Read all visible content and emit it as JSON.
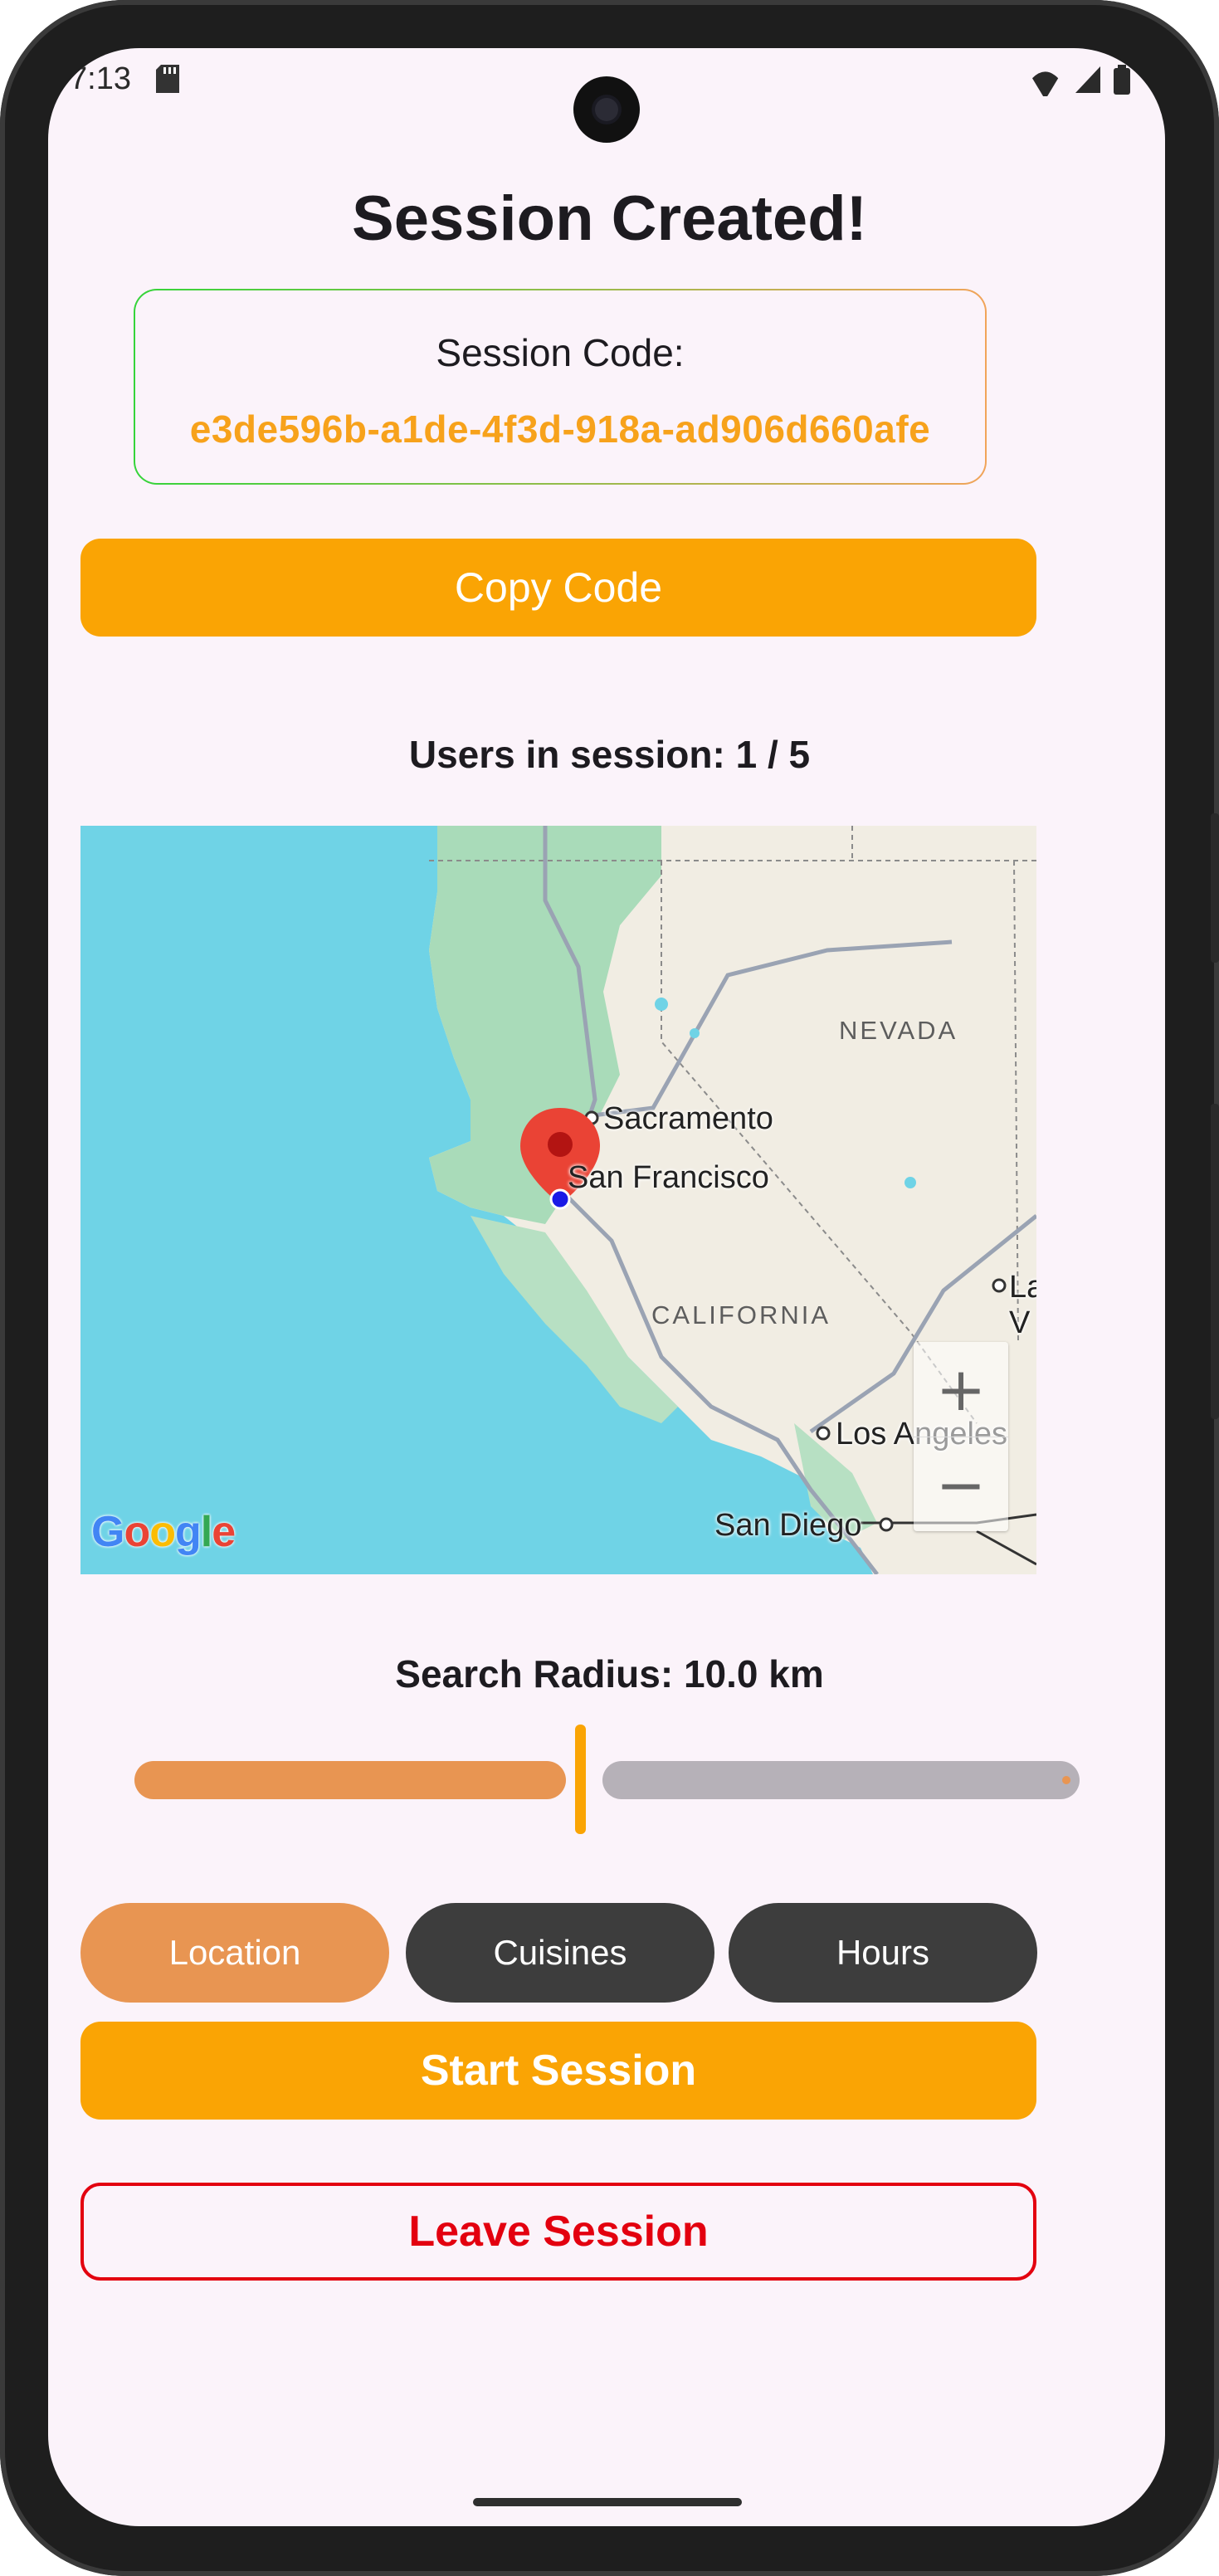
{
  "status_bar": {
    "time": "7:13"
  },
  "title": "Session Created!",
  "session": {
    "code_label": "Session Code:",
    "code": "e3de596b-a1de-4f3d-918a-ad906d660afe"
  },
  "copy_button": "Copy Code",
  "users_text": "Users in session: 1 / 5",
  "map": {
    "labels": {
      "nevada": "NEVADA",
      "sacramento": "Sacramento",
      "san_francisco": "San Francisco",
      "california": "CALIFORNIA",
      "las_vegas": "Las V",
      "los_angeles": "Los Angeles",
      "san_diego": "San Diego"
    },
    "google_logo": "Google",
    "zoom_in": "+",
    "zoom_out": "−"
  },
  "search_radius": {
    "label": "Search Radius: 10.0 km",
    "value_fraction": 0.48
  },
  "filter_tabs": [
    {
      "label": "Location",
      "selected": true
    },
    {
      "label": "Cuisines",
      "selected": false
    },
    {
      "label": "Hours",
      "selected": false
    }
  ],
  "start_button": "Start Session",
  "leave_button": "Leave Session",
  "colors": {
    "accent": "#faa404",
    "selected_tab": "#e89552",
    "unselected_tab": "#3d3d3d",
    "danger": "#e3000f",
    "code_text": "#f7a21b",
    "background": "#fbf3fa"
  }
}
